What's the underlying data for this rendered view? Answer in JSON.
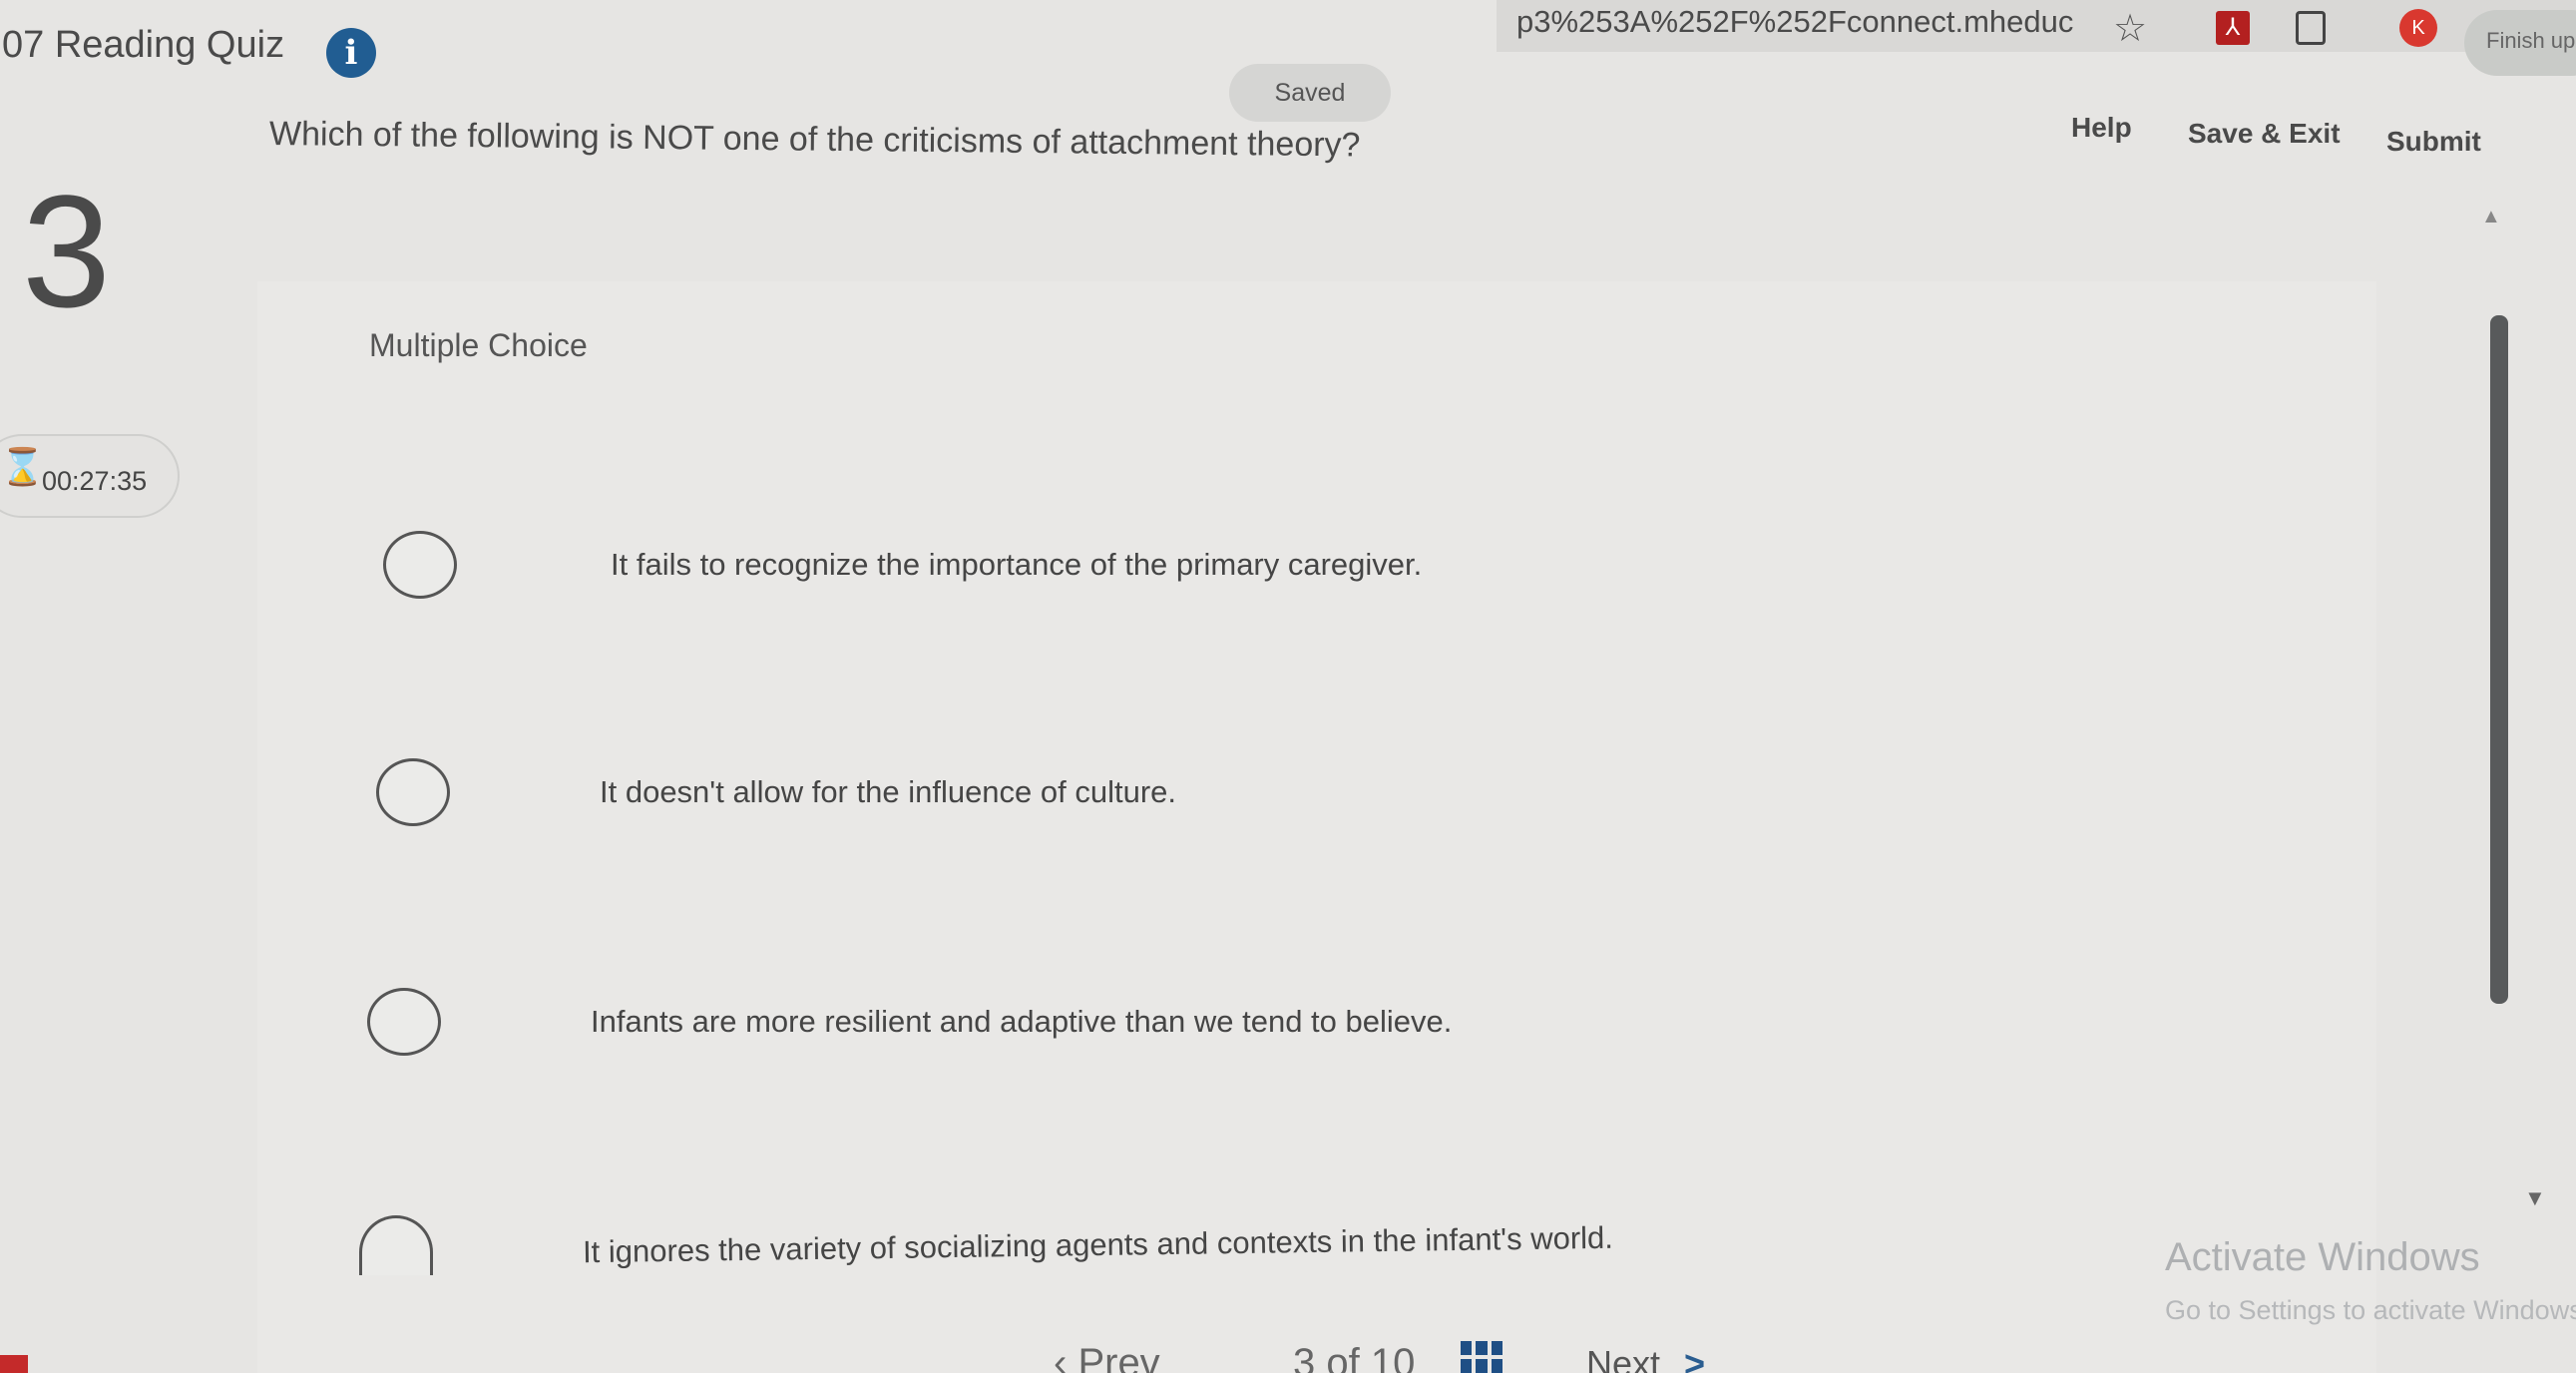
{
  "browser": {
    "url_fragment": "p3%253A%252F%252Fconnect.mheduc...",
    "finish_label": "Finish up",
    "profile_initial": "K"
  },
  "header": {
    "quiz_title": "07 Reading Quiz",
    "saved_status": "Saved",
    "help_label": "Help",
    "save_exit_label": "Save & Exit",
    "submit_label": "Submit"
  },
  "question": {
    "number": "3",
    "text": "Which of the following is NOT one of the criticisms of attachment theory?",
    "type": "Multiple Choice",
    "options": [
      {
        "text": "It fails to recognize the importance of the primary caregiver."
      },
      {
        "text": "It doesn't allow for the influence of culture."
      },
      {
        "text": "Infants are more resilient and adaptive than we tend to believe."
      },
      {
        "text": "It ignores the variety of socializing agents and contexts in the infant's world."
      }
    ]
  },
  "timer": {
    "value": "00:27:35"
  },
  "footer": {
    "prev_label": "Prev",
    "page_indicator": "3 of 10",
    "next_label": "Next"
  },
  "watermark": {
    "title": "Activate Windows",
    "subtitle": "Go to Settings to activate Windows."
  }
}
